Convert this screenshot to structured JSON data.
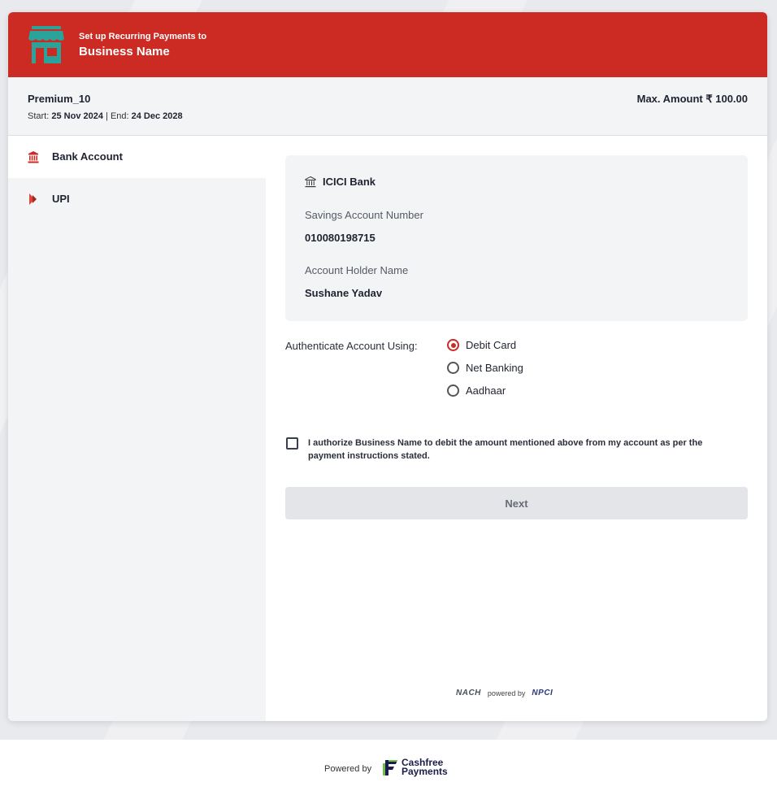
{
  "header": {
    "subtitle": "Set up Recurring Payments to",
    "title": "Business Name",
    "icon": "store-icon"
  },
  "plan": {
    "name": "Premium_10",
    "start_label": "Start:",
    "start_date": "25 Nov 2024",
    "separator": "| End:",
    "end_date": "24 Dec 2028",
    "max_amount": "Max. Amount ₹ 100.00"
  },
  "sidebar": {
    "items": [
      {
        "label": "Bank Account",
        "icon": "bank-icon",
        "active": true
      },
      {
        "label": "UPI",
        "icon": "upi-icon",
        "active": false
      }
    ]
  },
  "bank": {
    "name": "ICICI Bank",
    "account_label": "Savings Account Number",
    "account_number": "010080198715",
    "holder_label": "Account Holder Name",
    "holder_name": "Sushane Yadav"
  },
  "auth": {
    "label": "Authenticate Account Using:",
    "options": [
      "Debit Card",
      "Net Banking",
      "Aadhaar"
    ],
    "selected": "Debit Card"
  },
  "consent": {
    "text": "I authorize Business Name to debit the amount mentioned above from my account as per the payment instructions stated."
  },
  "next_label": "Next",
  "nach": {
    "nach_logo": "NACH",
    "powered_by": "powered by",
    "npci_logo": "NPCI"
  },
  "footer": {
    "powered_by": "Powered by",
    "brand_line1": "Cashfree",
    "brand_line2": "Payments"
  },
  "colors": {
    "brand_red": "#cc2b23",
    "store_teal": "#2aa39a",
    "cashfree_green": "#6fc04a"
  }
}
